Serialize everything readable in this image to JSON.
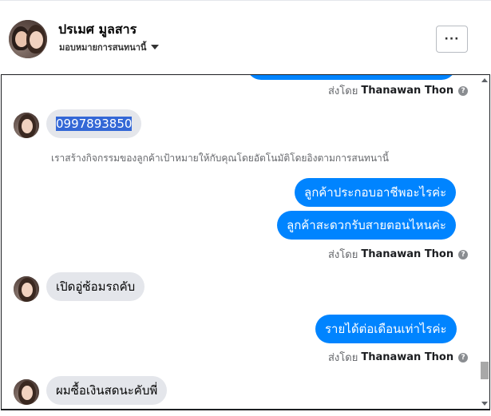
{
  "header": {
    "contact_name": "ปรเมศ มูลสาร",
    "assign_label": "มอบหมายการสนทนานี้",
    "more_label": "···"
  },
  "chat": {
    "sent_by_prefix": "ส่งโดย",
    "sender_name": "Thanawan Thon",
    "help_glyph": "?",
    "messages": [
      {
        "kind": "sent-by"
      },
      {
        "kind": "incoming",
        "text": "0997893850",
        "selected": true
      },
      {
        "kind": "system",
        "text": "เราสร้างกิจกรรมของลูกค้าเป้าหมายให้กับคุณโดยอัตโนมัติโดยอิงตามการสนทนานี้"
      },
      {
        "kind": "outgoing",
        "text": "ลูกค้าประกอบอาชีพอะไรค่ะ"
      },
      {
        "kind": "outgoing",
        "text": "ลูกค้าสะดวกรับสายตอนไหนค่ะ"
      },
      {
        "kind": "sent-by"
      },
      {
        "kind": "incoming",
        "text": "เปิดอู่ซ้อมรถคับ"
      },
      {
        "kind": "outgoing",
        "text": "รายได้ต่อเดือนเท่าไรค่ะ"
      },
      {
        "kind": "sent-by"
      },
      {
        "kind": "incoming",
        "text": "ผมซื้อเงินสดนะคับพี่"
      }
    ]
  },
  "colors": {
    "outgoing_bubble": "#0084ff",
    "incoming_bubble": "#e4e6eb",
    "selection": "#3367d6"
  }
}
